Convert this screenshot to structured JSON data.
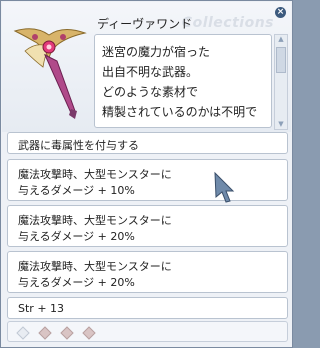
{
  "item": {
    "name": "ディーヴァワンド",
    "watermark": "Collections",
    "description": [
      "迷宮の魔力が宿った",
      "出自不明な武器。",
      "どのような素材で",
      "精製されているのかは不明で"
    ]
  },
  "effects": {
    "poison": "武器に毒属性を付与する",
    "bonus1_line1": "魔法攻撃時、大型モンスターに",
    "bonus1_line2": "与えるダメージ + 10%",
    "bonus2_line1": "魔法攻撃時、大型モンスターに",
    "bonus2_line2": "与えるダメージ + 20%",
    "bonus3_line1": "魔法攻撃時、大型モンスターに",
    "bonus3_line2": "与えるダメージ + 20%",
    "stat": "Str + 13"
  },
  "icons": {
    "close": "close-icon",
    "cursor": "cursor-arrow-icon",
    "slot": "card-slot-icon"
  },
  "card_slots": 4,
  "colors": {
    "window_bg": "#eef1f6",
    "border": "#b9c3d0",
    "slot_empty": "#d9c4c4",
    "slot_first": "#e8ecf2"
  }
}
